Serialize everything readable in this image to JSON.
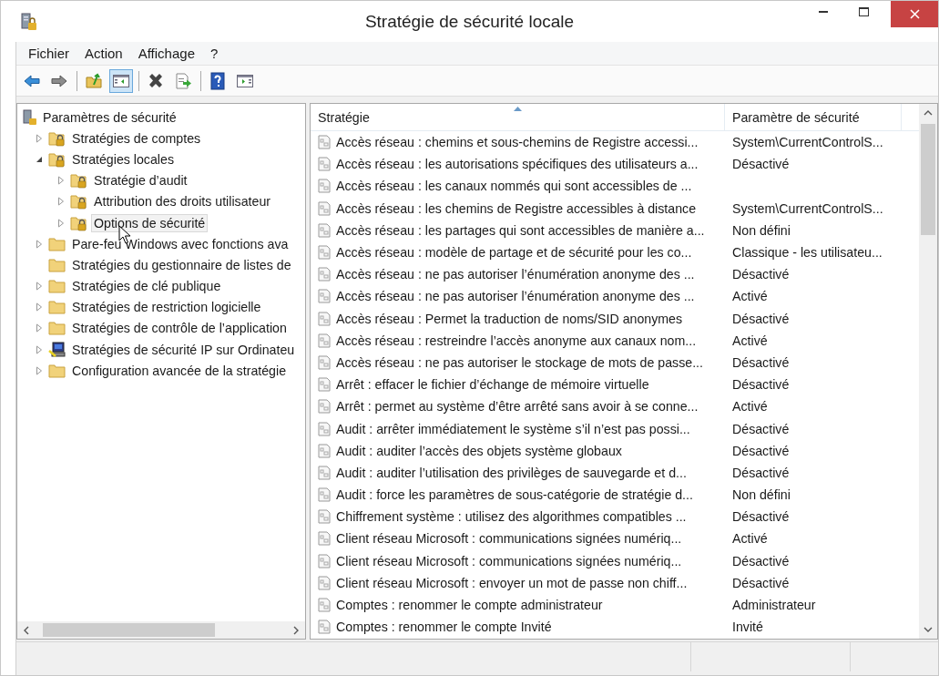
{
  "window": {
    "title": "Stratégie de sécurité locale"
  },
  "menu": [
    "Fichier",
    "Action",
    "Affichage",
    "?"
  ],
  "toolbar": [
    {
      "kind": "back",
      "pressed": false
    },
    {
      "kind": "forward",
      "pressed": false
    },
    {
      "kind": "up",
      "pressed": false
    },
    {
      "kind": "tree",
      "pressed": true
    },
    {
      "kind": "delete",
      "pressed": false
    },
    {
      "kind": "export",
      "pressed": false
    },
    {
      "kind": "help",
      "pressed": false
    },
    {
      "kind": "pane",
      "pressed": false
    }
  ],
  "tree": {
    "label": "Paramètres de sécurité",
    "children": [
      {
        "label": "Stratégies de comptes",
        "kind": "lockfolder",
        "expandable": true,
        "selected": false
      },
      {
        "label": "Stratégies locales",
        "kind": "lockfolder",
        "expandable": true,
        "expanded": true,
        "selected": false,
        "children": [
          {
            "label": "Stratégie d’audit",
            "kind": "lockfolder",
            "expandable": true,
            "selected": false
          },
          {
            "label": "Attribution des droits utilisateur",
            "kind": "lockfolder",
            "expandable": true,
            "selected": false
          },
          {
            "label": "Options de sécurité",
            "kind": "lockfolder",
            "expandable": true,
            "selected": true
          }
        ]
      },
      {
        "label": "Pare-feu Windows avec fonctions ava",
        "kind": "folder",
        "expandable": true,
        "selected": false
      },
      {
        "label": "Stratégies du gestionnaire de listes de",
        "kind": "folder",
        "expandable": false,
        "selected": false
      },
      {
        "label": "Stratégies de clé publique",
        "kind": "folder",
        "expandable": true,
        "selected": false
      },
      {
        "label": "Stratégies de restriction logicielle",
        "kind": "folder",
        "expandable": true,
        "selected": false
      },
      {
        "label": "Stratégies de contrôle de l’application",
        "kind": "folder",
        "expandable": true,
        "selected": false
      },
      {
        "label": "Stratégies de sécurité IP sur Ordinateu",
        "kind": "computer",
        "expandable": true,
        "selected": false
      },
      {
        "label": "Configuration avancée de la stratégie",
        "kind": "folder",
        "expandable": true,
        "selected": false
      }
    ]
  },
  "table": {
    "columns": [
      "Stratégie",
      "Paramètre de sécurité"
    ],
    "rows": [
      {
        "policy": "Accès réseau : chemins et sous-chemins de Registre accessi...",
        "setting": "System\\CurrentControlS..."
      },
      {
        "policy": "Accès réseau : les autorisations spécifiques des utilisateurs a...",
        "setting": "Désactivé"
      },
      {
        "policy": "Accès réseau : les canaux nommés qui sont accessibles de ..."
      },
      {
        "policy": "Accès réseau : les chemins de Registre accessibles à distance",
        "setting": "System\\CurrentControlS..."
      },
      {
        "policy": "Accès réseau : les partages qui sont accessibles de manière a...",
        "setting": "Non défini"
      },
      {
        "policy": "Accès réseau : modèle de partage et de sécurité pour les co...",
        "setting": "Classique - les utilisateu..."
      },
      {
        "policy": "Accès réseau : ne pas autoriser l’énumération anonyme des ...",
        "setting": "Désactivé"
      },
      {
        "policy": "Accès réseau : ne pas autoriser l’énumération anonyme des ...",
        "setting": "Activé"
      },
      {
        "policy": "Accès réseau : Permet la traduction de noms/SID anonymes",
        "setting": "Désactivé"
      },
      {
        "policy": "Accès réseau : restreindre l’accès anonyme aux canaux nom...",
        "setting": "Activé"
      },
      {
        "policy": "Accès réseau : ne pas autoriser le stockage de mots de passe...",
        "setting": "Désactivé"
      },
      {
        "policy": "Arrêt : effacer le fichier d’échange de mémoire virtuelle",
        "setting": "Désactivé"
      },
      {
        "policy": "Arrêt : permet au système d’être arrêté sans avoir à se conne...",
        "setting": "Activé"
      },
      {
        "policy": "Audit : arrêter immédiatement le système s’il n’est pas possi...",
        "setting": "Désactivé"
      },
      {
        "policy": "Audit : auditer l’accès des objets système globaux",
        "setting": "Désactivé"
      },
      {
        "policy": "Audit : auditer l’utilisation des privilèges de sauvegarde et d...",
        "setting": "Désactivé"
      },
      {
        "policy": "Audit : force les paramètres de sous-catégorie de stratégie d...",
        "setting": "Non défini"
      },
      {
        "policy": "Chiffrement système : utilisez des algorithmes compatibles ...",
        "setting": "Désactivé"
      },
      {
        "policy": "Client réseau Microsoft : communications signées numériq...",
        "setting": "Activé"
      },
      {
        "policy": "Client réseau Microsoft : communications signées numériq...",
        "setting": "Désactivé"
      },
      {
        "policy": "Client réseau Microsoft : envoyer un mot de passe non chiff...",
        "setting": "Désactivé"
      },
      {
        "policy": "Comptes : renommer le compte administrateur",
        "setting": "Administrateur"
      },
      {
        "policy": "Comptes : renommer le compte Invité",
        "setting": "Invité"
      }
    ]
  }
}
